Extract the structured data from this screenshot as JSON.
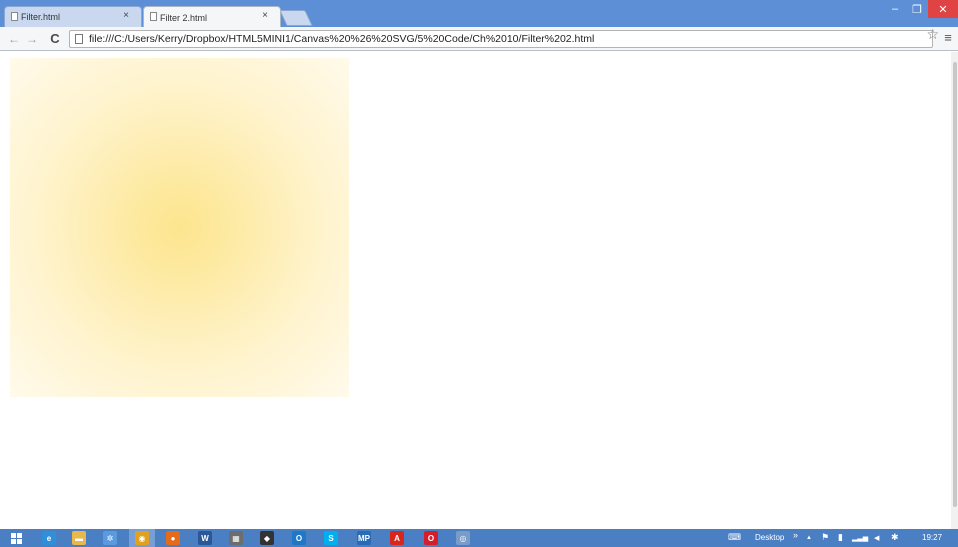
{
  "browser": {
    "tabs": [
      {
        "title": "Filter.html",
        "close_glyph": "×"
      },
      {
        "title": "Filter 2.html",
        "close_glyph": "×"
      }
    ],
    "window_controls": {
      "minimize": "–",
      "restore": "❐",
      "close": "✕"
    },
    "nav": {
      "back": "←",
      "forward": "→",
      "reload": "C"
    },
    "address": "file:///C:/Users/Kerry/Dropbox/HTML5MINI1/Canvas%20%26%20SVG/5%20Code/Ch%2010/Filter%202.html",
    "bookmark_glyph": "☆",
    "menu_glyph": "≡"
  },
  "page": {
    "square_center_color": "#fde58f",
    "square_edge_color": "#fffaeb"
  },
  "taskbar": {
    "start_icon": "windows-start-icon",
    "pinned_apps": [
      {
        "name": "internet-explorer-icon",
        "glyph": "e",
        "color": "#2f8fd8"
      },
      {
        "name": "file-explorer-icon",
        "glyph": "▬",
        "color": "#e8b94a"
      },
      {
        "name": "app-icon",
        "glyph": "✲",
        "color": "#5a9be0"
      },
      {
        "name": "chrome-icon",
        "glyph": "◉",
        "color": "#e0a020"
      },
      {
        "name": "firefox-icon",
        "glyph": "●",
        "color": "#e56a1a"
      },
      {
        "name": "word-icon",
        "glyph": "W",
        "color": "#2b5797"
      },
      {
        "name": "calculator-icon",
        "glyph": "▦",
        "color": "#6d6d6d"
      },
      {
        "name": "inkscape-icon",
        "glyph": "◆",
        "color": "#333333"
      },
      {
        "name": "outlook-icon",
        "glyph": "O",
        "color": "#1e78c8"
      },
      {
        "name": "skype-icon",
        "glyph": "S",
        "color": "#00aff0"
      },
      {
        "name": "mp-icon",
        "glyph": "MP",
        "color": "#2a6bb8"
      },
      {
        "name": "acrobat-icon",
        "glyph": "A",
        "color": "#d8261c"
      },
      {
        "name": "opera-icon",
        "glyph": "O",
        "color": "#d51e2c"
      },
      {
        "name": "app-icon-2",
        "glyph": "◎",
        "color": "#7a9cc8"
      }
    ],
    "tray": {
      "keyboard_glyph": "⌨",
      "desktop_label": "Desktop",
      "expand_glyph": "»",
      "up_arrow": "▲",
      "flag_glyph": "⚑",
      "battery_glyph": "▮",
      "signal_glyph": "▂▃▅",
      "volume_glyph": "◀",
      "network_glyph": "✱",
      "clock": "19:27"
    }
  }
}
